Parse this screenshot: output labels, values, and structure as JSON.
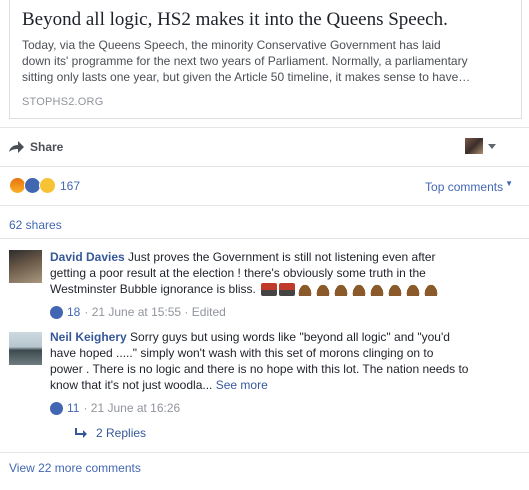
{
  "preview": {
    "title": "Beyond all logic, HS2 makes it into the Queens Speech.",
    "description": [
      "Today, via the Queens Speech, the minority Conservative Government has laid",
      "down its' programme for the next two years of Parliament. Normally, a parliamentary",
      "sitting only lasts one year, but given the Article 50 timeline, it makes sense to have…"
    ],
    "domain": "STOPHS2.ORG"
  },
  "actions": {
    "share_label": "Share",
    "share_icon": "share-arrow-icon"
  },
  "reactions": {
    "icons": [
      "angry",
      "like",
      "sad"
    ],
    "count": "167"
  },
  "top_comments_label": "Top comments",
  "shares_label": "62 shares",
  "comments": [
    {
      "author": "David Davies",
      "lines": [
        " Just proves the Government is still not listening even after",
        "getting a poor result at the election ! there's obviously some truth in the",
        "Westminster Bubble ignorance is bliss. "
      ],
      "emoji": [
        "train",
        "train",
        "poo",
        "poo",
        "poo",
        "poo",
        "poo",
        "poo",
        "poo",
        "poo"
      ],
      "likes": "18",
      "meta": "· 21 June at 15:55 · Edited"
    },
    {
      "author": "Neil Keighery",
      "lines": [
        " Sorry guys but using words like \"beyond all logic\" and \"you'd",
        "have hoped .....\" simply won't wash with this set of morons clinging on to",
        "power . There is no logic and there is no hope with this lot. The nation needs to",
        "know that it's not just woodla... "
      ],
      "see_more": "See more",
      "likes": "11",
      "meta": "· 21 June at 16:26",
      "replies": "2 Replies"
    }
  ],
  "view_more": "View 22 more comments",
  "colors": {
    "link": "#4267b2",
    "author": "#365899",
    "meta": "#90949c"
  }
}
